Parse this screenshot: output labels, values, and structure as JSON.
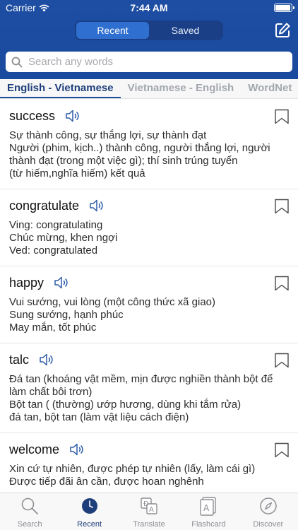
{
  "status": {
    "carrier": "Carrier",
    "time": "7:44 AM",
    "battery_level": 0.95
  },
  "segments": [
    {
      "label": "Recent",
      "active": true
    },
    {
      "label": "Saved",
      "active": false
    }
  ],
  "search": {
    "placeholder": "Search any words",
    "value": ""
  },
  "tabs": [
    {
      "label": "English - Vietnamese",
      "active": true
    },
    {
      "label": "Vietnamese - English",
      "active": false
    },
    {
      "label": "WordNet",
      "active": false
    }
  ],
  "entries": [
    {
      "word": "success",
      "definitions": [
        "Sự thành công, sự thắng lợi, sự thành đạt",
        "Người (phim, kịch..) thành công, người thắng lợi, người thành đạt (trong một việc gì); thí sinh trúng tuyển",
        "(từ hiếm,nghĩa hiếm) kết quả"
      ]
    },
    {
      "word": "congratulate",
      "definitions": [
        "Ving: congratulating",
        "Chúc mừng, khen ngợi",
        "Ved: congratulated"
      ]
    },
    {
      "word": "happy",
      "definitions": [
        "Vui sướng, vui lòng (một công thức xã giao)",
        "Sung sướng, hạnh phúc",
        "May mắn, tốt phúc"
      ]
    },
    {
      "word": "talc",
      "definitions": [
        "Đá tan (khoáng vật mềm, mịn được nghiền thành bột để làm chất bôi trơn)",
        "Bột tan ( (thường) ướp hương, dùng khi tắm rửa)",
        "đá tan, bột tan (làm vật liệu cách điện)"
      ]
    },
    {
      "word": "welcome",
      "definitions": [
        "Xin cứ tự nhiên, được phép tự nhiên (lấy, làm cái gì)",
        "Được tiếp đãi ân cần, được hoan nghênh"
      ]
    }
  ],
  "tabbar": [
    {
      "label": "Search",
      "icon": "search-icon",
      "active": false
    },
    {
      "label": "Recent",
      "icon": "clock-icon",
      "active": true
    },
    {
      "label": "Translate",
      "icon": "translate-icon",
      "active": false
    },
    {
      "label": "Flashcard",
      "icon": "flashcard-icon",
      "active": false
    },
    {
      "label": "Discover",
      "icon": "compass-icon",
      "active": false
    }
  ],
  "colors": {
    "header": "#1e4ea3",
    "accent": "#1f3f7a",
    "segment_active": "#2f6fd0"
  }
}
